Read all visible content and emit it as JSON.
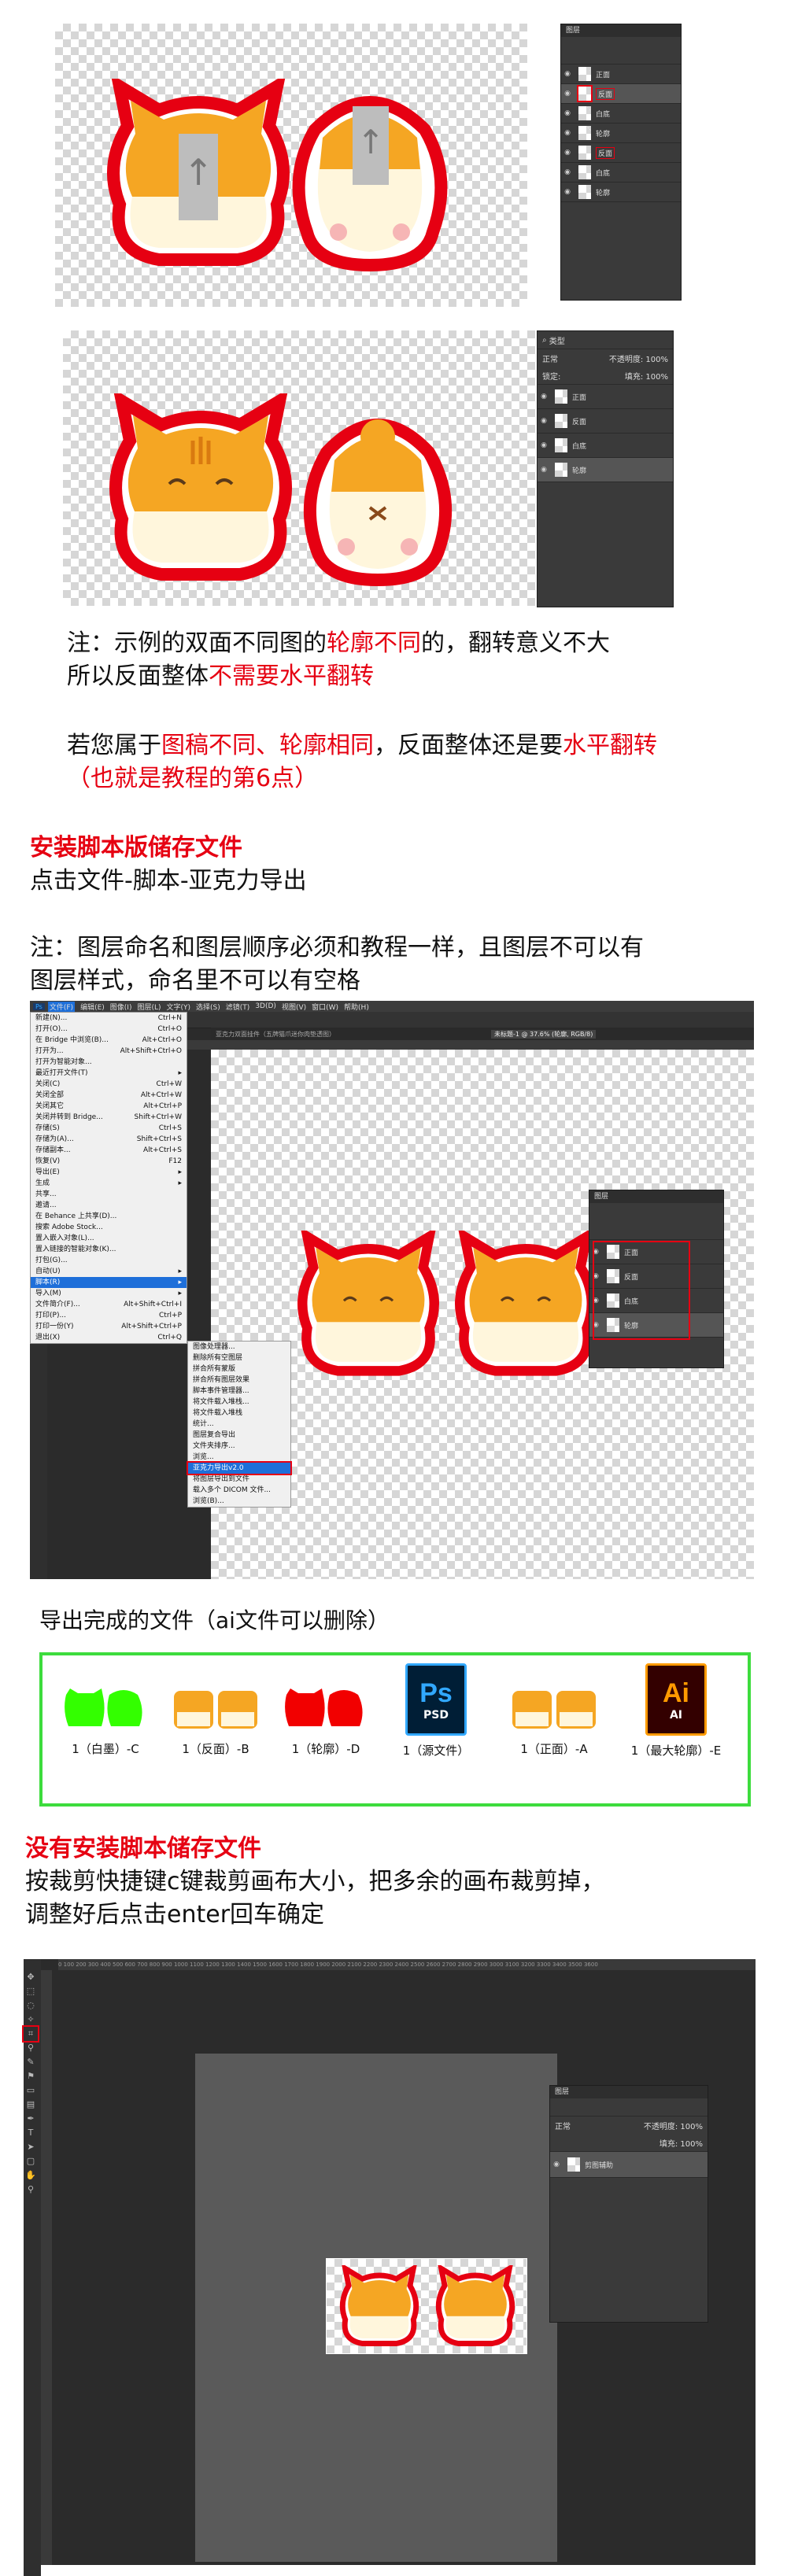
{
  "panel1": {
    "title": "图层",
    "rows": [
      "正面",
      "反面",
      "白底",
      "轮廓",
      "反面",
      "白底",
      "轮廓"
    ],
    "arrow": "↑"
  },
  "panel2": {
    "title": "类型",
    "mode": "正常",
    "opacity_label": "不透明度: 100%",
    "fill_label": "填充: 100%",
    "lock_label": "锁定:",
    "rows": [
      "正面",
      "反面",
      "白底",
      "轮廓"
    ]
  },
  "notes": {
    "line1_a": "注：示例的双面不同图的",
    "line1_b": "轮廓不同",
    "line1_c": "的，翻转意义不大",
    "line2_a": "所以反面整体",
    "line2_b": "不需要水平翻转",
    "line3_a": "若您属于",
    "line3_b": "图稿不同、轮廓相同",
    "line3_c": "，反面整体还是要",
    "line3_d": "水平翻转",
    "line4": "（也就是教程的第6点）"
  },
  "section1": {
    "heading": "安装脚本版储存文件",
    "sub": "点击文件-脚本-亚克力导出",
    "note1": "注：图层命名和图层顺序必须和教程一样，且图层不可以有",
    "note2": "图层样式，命名里不可以有空格"
  },
  "ps1": {
    "menubar": [
      "文件(F)",
      "编辑(E)",
      "图像(I)",
      "图层(L)",
      "文字(Y)",
      "选择(S)",
      "滤镜(T)",
      "3D(D)",
      "视图(V)",
      "窗口(W)",
      "帮助(H)"
    ],
    "tab1": "亚克力双面挂件（五牌猫爪迷你肉垫透图）",
    "tab2": "未标题-1 @ 37.6% (轮廓, RGB/8)",
    "file_menu": [
      {
        "label": "新建(N)...",
        "key": "Ctrl+N"
      },
      {
        "label": "打开(O)...",
        "key": "Ctrl+O"
      },
      {
        "label": "在 Bridge 中浏览(B)...",
        "key": "Alt+Ctrl+O"
      },
      {
        "label": "打开为...",
        "key": "Alt+Shift+Ctrl+O"
      },
      {
        "label": "打开为智能对象...",
        "key": ""
      },
      {
        "label": "最近打开文件(T)",
        "key": "▸"
      },
      {
        "label": "关闭(C)",
        "key": "Ctrl+W"
      },
      {
        "label": "关闭全部",
        "key": "Alt+Ctrl+W"
      },
      {
        "label": "关闭其它",
        "key": "Alt+Ctrl+P"
      },
      {
        "label": "关闭并转到 Bridge...",
        "key": "Shift+Ctrl+W"
      },
      {
        "label": "存储(S)",
        "key": "Ctrl+S"
      },
      {
        "label": "存储为(A)...",
        "key": "Shift+Ctrl+S"
      },
      {
        "label": "存储副本...",
        "key": "Alt+Ctrl+S"
      },
      {
        "label": "恢复(V)",
        "key": "F12"
      },
      {
        "label": "导出(E)",
        "key": "▸"
      },
      {
        "label": "生成",
        "key": "▸"
      },
      {
        "label": "共享...",
        "key": ""
      },
      {
        "label": "邀请...",
        "key": ""
      },
      {
        "label": "在 Behance 上共享(D)...",
        "key": ""
      },
      {
        "label": "搜索 Adobe Stock...",
        "key": ""
      },
      {
        "label": "置入嵌入对象(L)...",
        "key": ""
      },
      {
        "label": "置入链接的智能对象(K)...",
        "key": ""
      },
      {
        "label": "打包(G)...",
        "key": ""
      },
      {
        "label": "自动(U)",
        "key": "▸"
      },
      {
        "label": "脚本(R)",
        "key": "▸"
      },
      {
        "label": "导入(M)",
        "key": "▸"
      },
      {
        "label": "文件简介(F)...",
        "key": "Alt+Shift+Ctrl+I"
      },
      {
        "label": "打印(P)...",
        "key": "Ctrl+P"
      },
      {
        "label": "打印一份(Y)",
        "key": "Alt+Shift+Ctrl+P"
      },
      {
        "label": "退出(X)",
        "key": "Ctrl+Q"
      }
    ],
    "script_menu": [
      "图像处理器...",
      "删除所有空图层",
      "拼合所有蒙版",
      "拼合所有图层效果",
      "脚本事件管理器...",
      "将文件载入堆栈...",
      "将文件载入堆栈",
      "统计...",
      "图层复合导出",
      "文件夹排序...",
      "浏览...",
      "亚克力导出v2.0",
      "将图层导出到文件",
      "载入多个 DICOM 文件...",
      "浏览(B)..."
    ],
    "script_highlight": "亚克力导出v2.0",
    "layers_title": "图层",
    "layers": [
      "正面",
      "反面",
      "白底",
      "轮廓"
    ]
  },
  "exports": {
    "heading": "导出完成的文件（ai文件可以删除）",
    "files": [
      {
        "label": "1（白墨）-C"
      },
      {
        "label": "1（反面）-B"
      },
      {
        "label": "1（轮廓）-D"
      },
      {
        "label": "1（源文件）"
      },
      {
        "label": "1（正面）-A"
      },
      {
        "label": "1（最大轮廓）-E"
      }
    ],
    "psd_big": "Ps",
    "psd_small": "PSD",
    "ai_big": "Ai",
    "ai_small": "AI"
  },
  "section2": {
    "heading": "没有安装脚本储存文件",
    "line1": "按裁剪快捷键c键裁剪画布大小，把多余的画布裁剪掉，",
    "line2": "调整好后点击enter回车确定"
  },
  "ps2": {
    "ruler": "0 100 200 300 400 500 600 700 800 900 1000 1100 1200 1300 1400 1500 1600 1700 1800 1900 2000 2100 2200 2300 2400 2500 2600 2700 2800 2900 3000 3100 3200 3300 3400 3500 3600",
    "layers_title": "图层",
    "mode": "正常",
    "opacity": "不透明度: 100%",
    "fill": "填充: 100%",
    "layer": "剪图辅助"
  },
  "colors": {
    "accent_red": "#e60012",
    "green_border": "#3ddc3d",
    "ps_dark": "#2b2b2b",
    "panel": "#3a3a3a"
  }
}
